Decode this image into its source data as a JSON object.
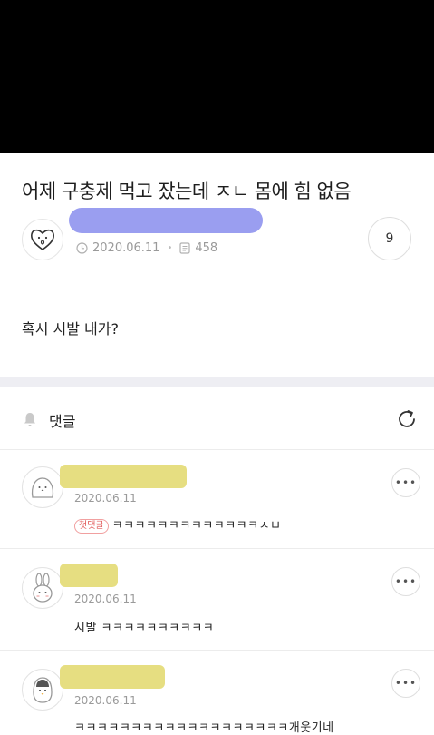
{
  "post": {
    "title": "어제 구충제 먹고 잤는데 ㅈㄴ 몸에 힘 없음",
    "date": "2020.06.11",
    "views": "458",
    "comment_count": "9",
    "body": "혹시 시발 내가?"
  },
  "comments_header": {
    "label": "댓글"
  },
  "comments": [
    {
      "date": "2020.06.11",
      "badge": "첫댓글",
      "text": "ㅋㅋㅋㅋㅋㅋㅋㅋㅋㅋㅋㅋㅋㅅㅂ",
      "avatar": "blob-character-icon"
    },
    {
      "date": "2020.06.11",
      "text": "시발 ㅋㅋㅋㅋㅋㅋㅋㅋㅋㅋ",
      "avatar": "rabbit-character-icon"
    },
    {
      "date": "2020.06.11",
      "text": "ㅋㅋㅋㅋㅋㅋㅋㅋㅋㅋㅋㅋㅋㅋㅋㅋㅋㅋㅋ개웃기네",
      "avatar": "penguin-character-icon"
    }
  ],
  "colors": {
    "redaction_blue": "#8f93ee",
    "redaction_yellow": "#e5dc7a",
    "badge_red": "#e25a5a",
    "section_band": "#eeeef3"
  }
}
